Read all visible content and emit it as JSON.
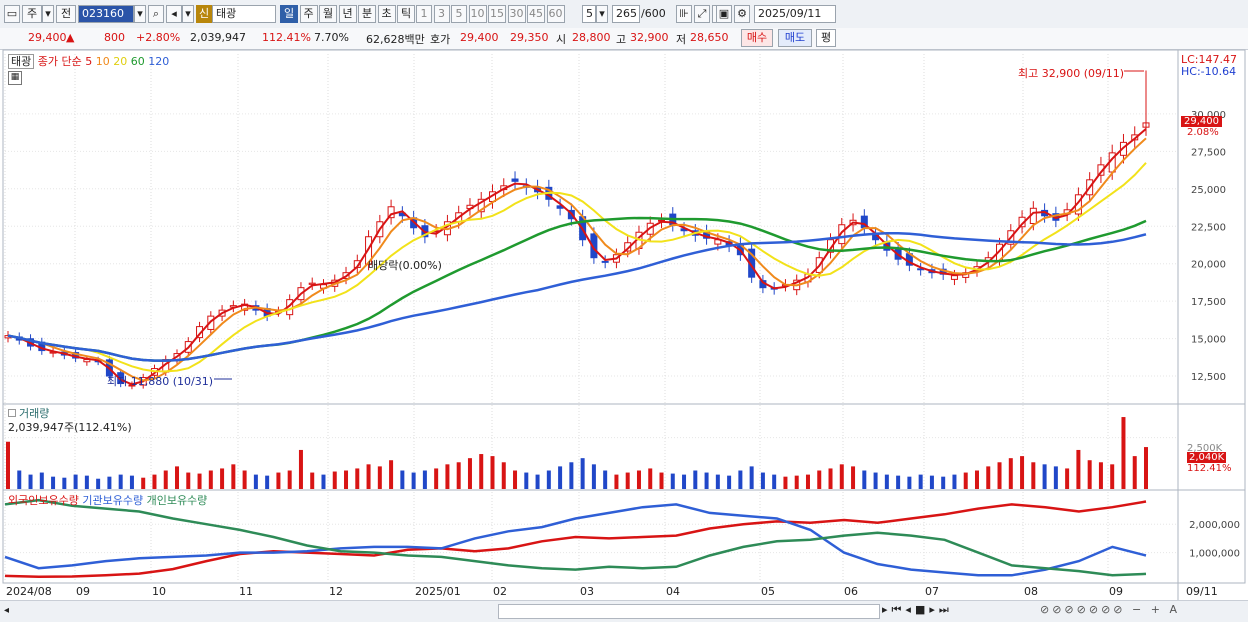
{
  "toolbar": {
    "mode1": "주",
    "mode2": "전",
    "code": "023160",
    "badge": "신",
    "name": "태광",
    "periods": [
      "일",
      "주",
      "월",
      "년",
      "분",
      "초",
      "틱"
    ],
    "active_period": "일",
    "intervals": [
      "1",
      "3",
      "5",
      "10",
      "15",
      "30",
      "45",
      "60"
    ],
    "custom_interval": "5",
    "count": "265",
    "count_max": "/600",
    "date": "2025/09/11"
  },
  "quote": {
    "price": "29,400",
    "arrow": "▲",
    "change": "800",
    "change_pct": "+2.80%",
    "volume": "2,039,947",
    "volume_ratio": "112.41%",
    "turnover_pct": "7.70%",
    "amount": "62,628백만",
    "ask_label": "호가",
    "ask": "29,400",
    "bid": "29,350",
    "open_label": "시",
    "open": "28,800",
    "high_label": "고",
    "high": "32,900",
    "low_label": "저",
    "low": "28,650",
    "buy_button": "매수",
    "sell_button": "매도",
    "avg_button": "평"
  },
  "price_panel": {
    "legend_name": "태광",
    "legend_ma": "종가 단순 5",
    "ma_periods": [
      "10",
      "20",
      "60",
      "120"
    ],
    "lc": "LC:147.47",
    "hc": "HC:-10.64",
    "current_label": "29,400",
    "current_pct": "2.08%",
    "high_annotation": "최고 32,900 (09/11)",
    "low_annotation": "최저 11,880 (10/31)",
    "dividend_annotation": "배당락(0.00%)"
  },
  "volume_panel": {
    "title": "거래량",
    "value_text": "2,039,947주(112.41%)",
    "current_label": "2,040K",
    "current_pct": "112.41%",
    "axis_label": "2,500K"
  },
  "holdings_panel": {
    "legend": [
      "외국인보유수량",
      "기관보유수량",
      "개인보유수량"
    ],
    "axis_labels": [
      "2,000,000",
      "1,000,000"
    ]
  },
  "x_axis": {
    "labels": [
      "2024/08",
      "09",
      "10",
      "11",
      "12",
      "2025/01",
      "02",
      "03",
      "04",
      "05",
      "06",
      "07",
      "08",
      "09"
    ],
    "right_label": "09/11"
  },
  "colors": {
    "up": "#d81414",
    "down": "#2047c8",
    "ma5": "#d81414",
    "ma10": "#f08a1c",
    "ma20": "#f2e21a",
    "ma60": "#1f9a2f",
    "ma120": "#2f5fd6",
    "foreign": "#d81414",
    "institution": "#2f5fd6",
    "individual": "#2e8b57"
  },
  "chart_data": {
    "type": "line",
    "price_axis": [
      12500,
      15000,
      17500,
      20000,
      22500,
      25000,
      27500,
      30000
    ],
    "price_ylim": [
      10700,
      34000
    ],
    "x_months": [
      "2024/08",
      "09",
      "10",
      "11",
      "12",
      "2025/01",
      "02",
      "03",
      "04",
      "05",
      "06",
      "07",
      "08",
      "09"
    ],
    "close_series": {
      "name": "종가",
      "values": [
        15200,
        14900,
        14500,
        14200,
        14100,
        13900,
        13700,
        13600,
        13500,
        12500,
        12000,
        11900,
        12400,
        13000,
        13600,
        14000,
        14800,
        15800,
        16500,
        16900,
        17200,
        17300,
        16900,
        16500,
        16800,
        17600,
        18400,
        18700,
        18600,
        18900,
        19400,
        20200,
        21800,
        22800,
        23800,
        23200,
        22400,
        21800,
        22200,
        22800,
        23400,
        23900,
        24300,
        24800,
        25200,
        25500,
        25100,
        24800,
        24300,
        23700,
        23000,
        21600,
        20400,
        20100,
        20600,
        21400,
        22100,
        22700,
        22900,
        22600,
        22200,
        21900,
        21700,
        21600,
        21200,
        20600,
        19100,
        18400,
        18300,
        18600,
        18900,
        19300,
        20400,
        21600,
        22600,
        22900,
        22400,
        21600,
        20900,
        20300,
        19900,
        19600,
        19400,
        19300,
        19200,
        19400,
        19800,
        20400,
        21300,
        22200,
        23100,
        23700,
        23200,
        22900,
        23600,
        24600,
        25600,
        26600,
        27400,
        28100,
        28600,
        29400
      ]
    },
    "ma_series": [
      {
        "name": "5"
      },
      {
        "name": "10"
      },
      {
        "name": "20"
      },
      {
        "name": "60"
      },
      {
        "name": "120"
      }
    ],
    "volume_series": {
      "name": "거래량",
      "values": [
        2300,
        900,
        700,
        800,
        600,
        550,
        700,
        650,
        500,
        600,
        700,
        650,
        550,
        700,
        900,
        1100,
        800,
        750,
        900,
        1000,
        1200,
        900,
        700,
        650,
        800,
        900,
        1900,
        800,
        700,
        850,
        900,
        1000,
        1200,
        1100,
        1400,
        900,
        800,
        900,
        1000,
        1200,
        1300,
        1500,
        1700,
        1600,
        1300,
        900,
        800,
        700,
        900,
        1100,
        1300,
        1500,
        1200,
        900,
        700,
        800,
        900,
        1000,
        800,
        750,
        700,
        900,
        800,
        700,
        650,
        900,
        1100,
        800,
        700,
        600,
        650,
        700,
        900,
        1000,
        1200,
        1100,
        900,
        800,
        700,
        650,
        600,
        700,
        650,
        600,
        700,
        800,
        900,
        1100,
        1300,
        1500,
        1600,
        1300,
        1200,
        1100,
        1000,
        1900,
        1400,
        1300,
        1200,
        3500,
        1600,
        2040
      ]
    },
    "holdings": {
      "ylim": [
        0,
        3100000
      ],
      "series": [
        {
          "name": "외국인보유수량",
          "values": [
            180000,
            150000,
            160000,
            200000,
            260000,
            420000,
            700000,
            950000,
            1050000,
            1000000,
            950000,
            900000,
            1100000,
            1150000,
            1050000,
            1150000,
            1400000,
            1550000,
            1500000,
            1550000,
            1600000,
            1850000,
            2000000,
            2100000,
            2050000,
            2150000,
            2050000,
            2200000,
            2350000,
            2550000,
            2700000,
            2600000,
            2450000,
            2600000,
            2800000
          ]
        },
        {
          "name": "기관보유수량",
          "values": [
            850000,
            450000,
            550000,
            700000,
            800000,
            850000,
            900000,
            1000000,
            1000000,
            1050000,
            1150000,
            1200000,
            1200000,
            1150000,
            1500000,
            1750000,
            1900000,
            2200000,
            2400000,
            2600000,
            2700000,
            2400000,
            2300000,
            2200000,
            1800000,
            1000000,
            600000,
            400000,
            300000,
            200000,
            200000,
            400000,
            700000,
            1200000,
            900000
          ]
        },
        {
          "name": "개인보유수량",
          "values": [
            2700000,
            2850000,
            2650000,
            2550000,
            2450000,
            2200000,
            2000000,
            1800000,
            1550000,
            1250000,
            1050000,
            1000000,
            900000,
            850000,
            700000,
            550000,
            450000,
            400000,
            500000,
            450000,
            500000,
            900000,
            1200000,
            1400000,
            1450000,
            1600000,
            1700000,
            1600000,
            1450000,
            1000000,
            550000,
            450000,
            350000,
            200000,
            250000
          ]
        }
      ]
    }
  }
}
